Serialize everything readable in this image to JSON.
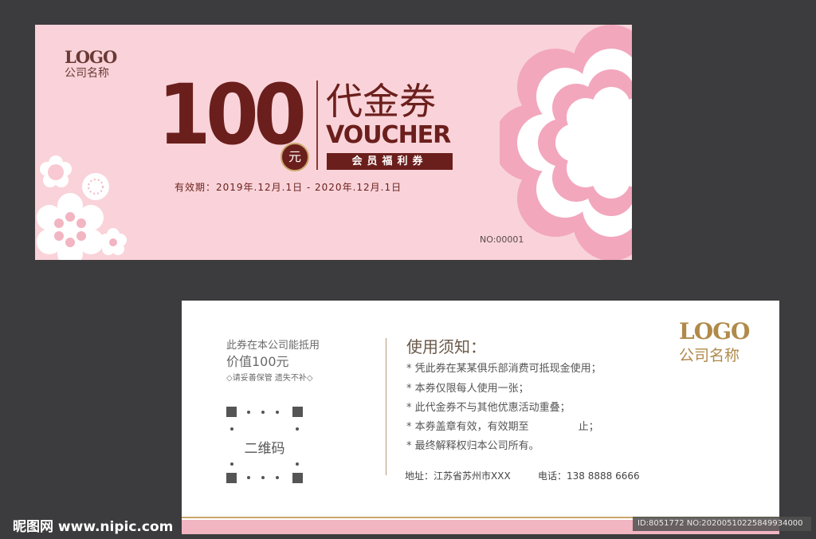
{
  "colors": {
    "background": "#3c3c3e",
    "front_bg": "#f9d3d9",
    "brand_dark": "#6b1f1c",
    "gold": "#c8a86b",
    "pink": "#f2b5c2"
  },
  "front": {
    "logo_en": "LOGO",
    "logo_cn": "公司名称",
    "amount": "100",
    "currency": "元",
    "title_cn": "代金券",
    "title_en": "VOUCHER",
    "tag": "会员福利券",
    "validity": "有效期：2019年.12月.1日 - 2020年.12月.1日",
    "serial": "NO:00001",
    "icons": [
      "flower-icon"
    ]
  },
  "back": {
    "usage_line": "此券在本公司能抵用",
    "value_line": "价值100元",
    "keep_note": "◇请妥善保管 遗失不补◇",
    "qr_label": "二维码",
    "notice_title": "使用须知：",
    "notice_items": [
      "* 凭此券在某某俱乐部消费可抵现金使用；",
      "* 本券仅限每人使用一张；",
      "* 此代金券不与其他优惠活动重叠；",
      "* 本券盖章有效，有效期至               止；",
      "* 最终解释权归本公司所有。"
    ],
    "address": "地址：江苏省苏州市XXX",
    "phone": "电话：138 8888 6666",
    "logo_en": "LOGO",
    "logo_cn": "公司名称"
  },
  "watermark": "昵图网 www.nipic.com",
  "image_tag": "ID:8051772 NO:20200510225849934000"
}
